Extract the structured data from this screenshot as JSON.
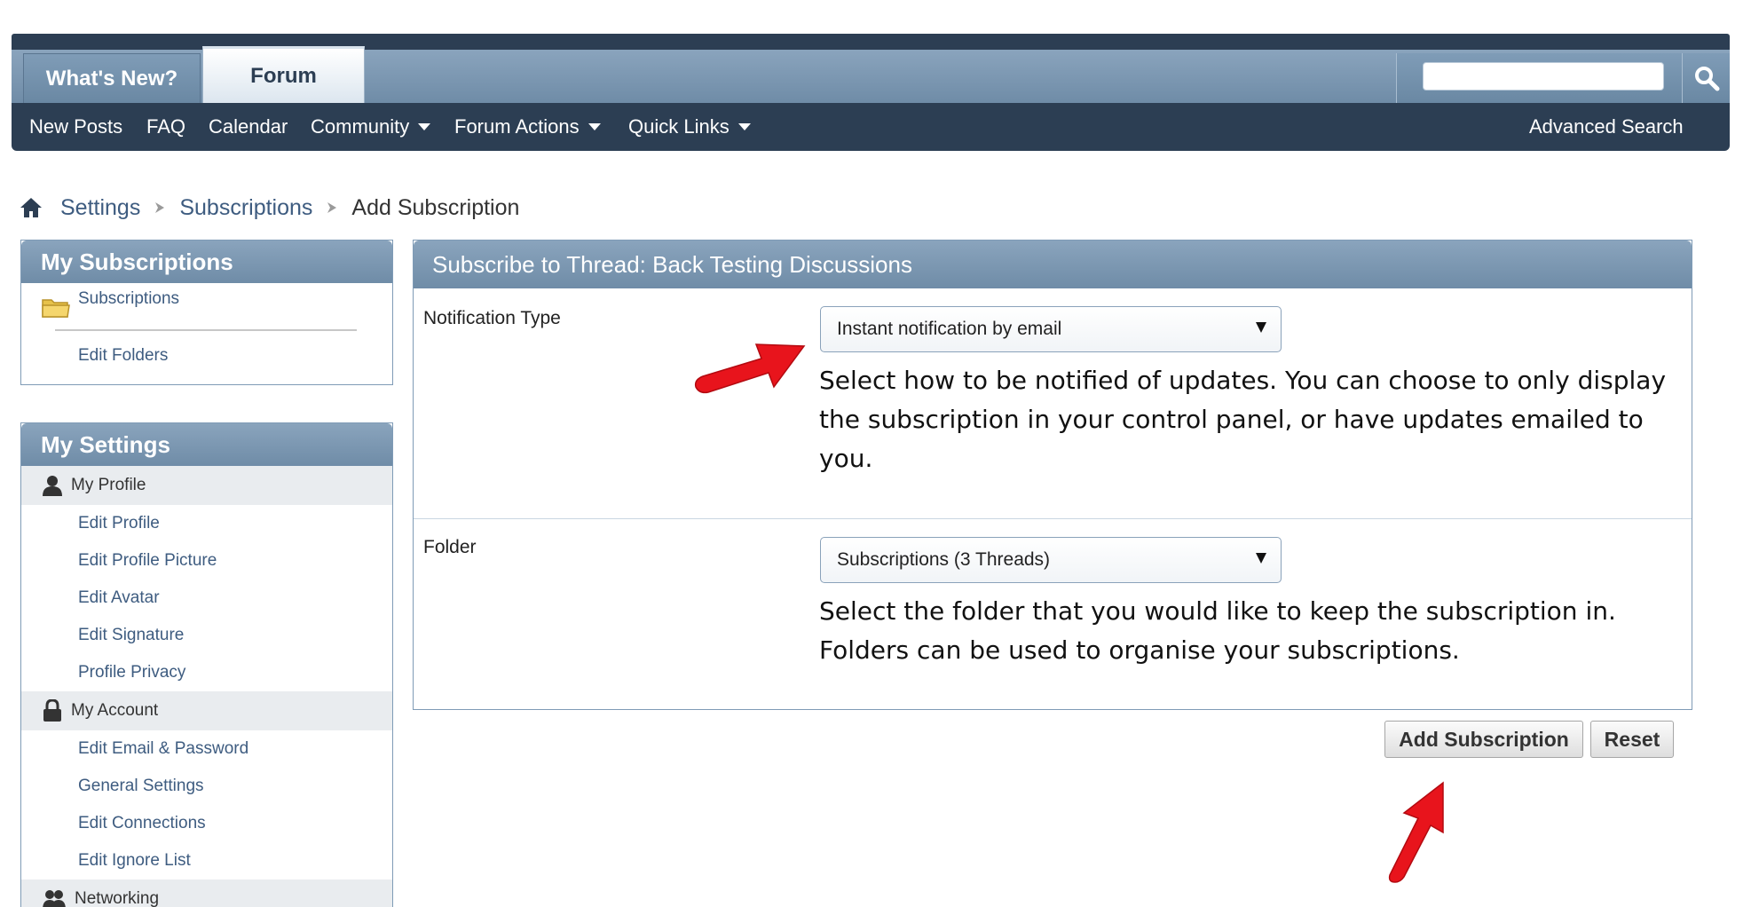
{
  "navbar": {
    "tabs": [
      {
        "label": "What's New?"
      },
      {
        "label": "Forum"
      }
    ],
    "links": [
      "New Posts",
      "FAQ",
      "Calendar",
      "Community",
      "Forum Actions",
      "Quick Links"
    ],
    "advanced_search": "Advanced Search",
    "search_placeholder": ""
  },
  "breadcrumb": {
    "items": [
      "Settings",
      "Subscriptions"
    ],
    "current": "Add Subscription"
  },
  "sidebar": {
    "subscriptions": {
      "title": "My Subscriptions",
      "folder": "Subscriptions",
      "edit_folders": "Edit Folders"
    },
    "settings": {
      "title": "My Settings",
      "profile_group": "My Profile",
      "profile_items": [
        "Edit Profile",
        "Edit Profile Picture",
        "Edit Avatar",
        "Edit Signature",
        "Profile Privacy"
      ],
      "account_group": "My Account",
      "account_items": [
        "Edit Email & Password",
        "General Settings",
        "Edit Connections",
        "Edit Ignore List"
      ],
      "networking_group": "Networking"
    }
  },
  "panel": {
    "title": "Subscribe to Thread: Back Testing Discussions",
    "notification": {
      "label": "Notification Type",
      "value": "Instant notification by email",
      "help": "Select how to be notified of updates. You can choose to only display the subscription in your control panel, or have updates emailed to you."
    },
    "folder": {
      "label": "Folder",
      "value": "Subscriptions (3 Threads)",
      "help": "Select the folder that you would like to keep the subscription in. Folders can be used to organise your subscriptions."
    }
  },
  "buttons": {
    "add": "Add Subscription",
    "reset": "Reset"
  },
  "colors": {
    "nav_dark": "#2c3e53",
    "header_blue": "#7f9bb6",
    "link_blue": "#3e5c80",
    "annotation_red": "#e8141c"
  }
}
